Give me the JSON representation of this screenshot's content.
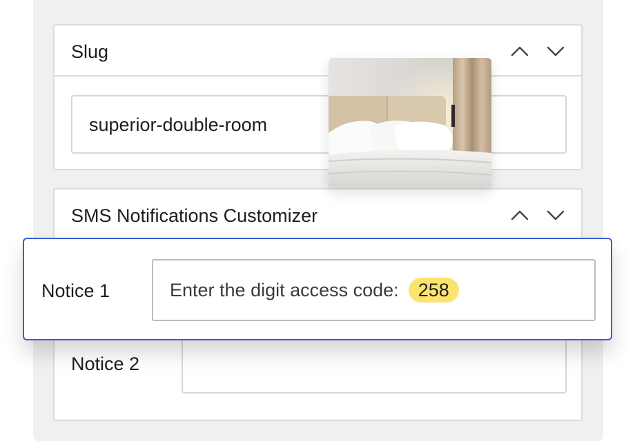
{
  "slug_panel": {
    "title": "Slug",
    "value": "superior-double-room",
    "up_icon": "chevron-up-icon",
    "down_icon": "chevron-down-icon"
  },
  "sms_panel": {
    "title": "SMS Notifications Customizer",
    "notice2_label": "Notice 2",
    "notice2_value": "",
    "up_icon": "chevron-up-icon",
    "down_icon": "chevron-down-icon"
  },
  "popup": {
    "notice1_label": "Notice 1",
    "notice1_text": "Enter the digit access code:",
    "code": "258"
  },
  "colors": {
    "focus_border": "#3b5bd6",
    "highlight": "#fbe46e",
    "background": "#f0f0f0"
  },
  "photo": {
    "subject": "hotel-bed-image"
  }
}
